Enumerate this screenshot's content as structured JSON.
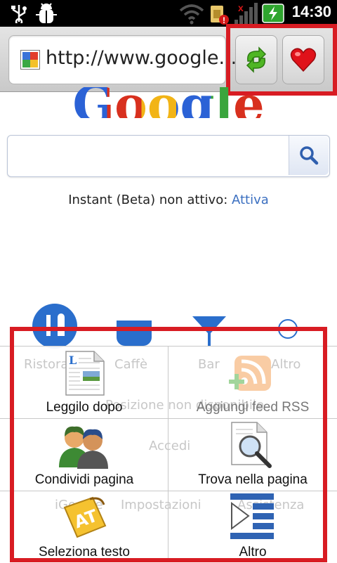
{
  "status_bar": {
    "time": "14:30"
  },
  "browser": {
    "url": "http://www.google..."
  },
  "page": {
    "logo": "Google",
    "instant_text": "Instant (Beta) non attivo: ",
    "instant_link": "Attiva",
    "bg_labels": [
      "Ristoranti",
      "Caffè",
      "Bar",
      "Altro"
    ],
    "bg_unavailable": "Posizione non disponibile",
    "bg_signin": "Accedi",
    "bg_footer": [
      "iGoogle",
      "Impostazioni",
      "Assistenza"
    ]
  },
  "menu": {
    "items": [
      {
        "label": "Leggilo dopo",
        "icon": "document-icon",
        "enabled": true
      },
      {
        "label": "Aggiungi feed RSS",
        "icon": "rss-feed-icon",
        "enabled": false
      },
      {
        "label": "Condividi pagina",
        "icon": "people-icon",
        "enabled": true
      },
      {
        "label": "Trova nella pagina",
        "icon": "find-icon",
        "enabled": true
      },
      {
        "label": "Seleziona testo",
        "icon": "select-text-icon",
        "enabled": true
      },
      {
        "label": "Altro",
        "icon": "more-list-icon",
        "enabled": true
      }
    ]
  },
  "colors": {
    "highlight": "#d81c23",
    "link": "#3b6fc0"
  }
}
